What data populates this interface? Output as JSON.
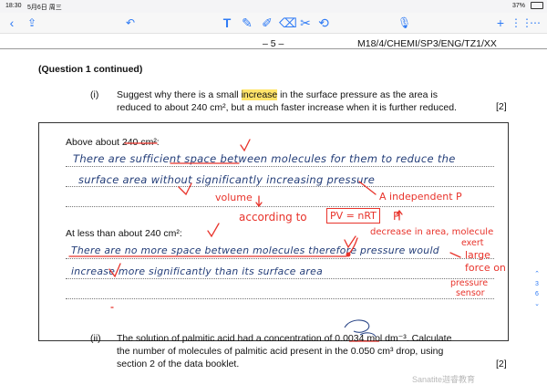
{
  "status": {
    "time": "18:30",
    "date": "5月6日 周三",
    "battery": "37%"
  },
  "page_header": {
    "number": "– 5 –",
    "code": "M18/4/CHEMI/SP3/ENG/TZ1/XX"
  },
  "question_continued": "(Question 1 continued)",
  "part_i": {
    "label": "(i)",
    "line1_pre": "Suggest why there is a small ",
    "line1_highlight": "increase",
    "line1_post": " in the surface pressure as the area is",
    "line2": "reduced to about 240 cm², but a much faster increase when it is further reduced.",
    "marks": "[2]"
  },
  "box": {
    "above_label": "Above about 240 cm²:",
    "below_label": "At less than about 240 cm²:",
    "hw_above_1": "There are sufficient space between molecules for them to reduce the",
    "hw_above_2": "surface area without significantly increasing pressure",
    "hw_below_1": "There are no more space between molecules therefore pressure would",
    "hw_below_2": "increase more significantly than its surface area"
  },
  "annotations": {
    "volume": "volume",
    "a_indep": "A independent P",
    "according": "according to",
    "formula": "PV = nRT",
    "p_arrow": "P",
    "decrease": "decrease in area, molecule",
    "exert": "exert",
    "large": "large",
    "force_on": "force on",
    "pressure": "pressure",
    "sensor": "sensor"
  },
  "part_ii": {
    "label": "(ii)",
    "line1": "The solution of palmitic acid had a concentration of 0.0034 mol dm⁻³. Calculate",
    "line2": "the number of molecules of palmitic acid present in the 0.050 cm³ drop, using",
    "line3": "section 2 of the data booklet.",
    "marks": "[2]"
  },
  "side_pager": {
    "current": "3",
    "total": "6"
  },
  "watermark": "Sanatite迦睿教育",
  "colors": {
    "ink": "#233d78",
    "red": "#e8332b",
    "accent": "#2f7bf5",
    "highlight": "#ffe46a"
  }
}
